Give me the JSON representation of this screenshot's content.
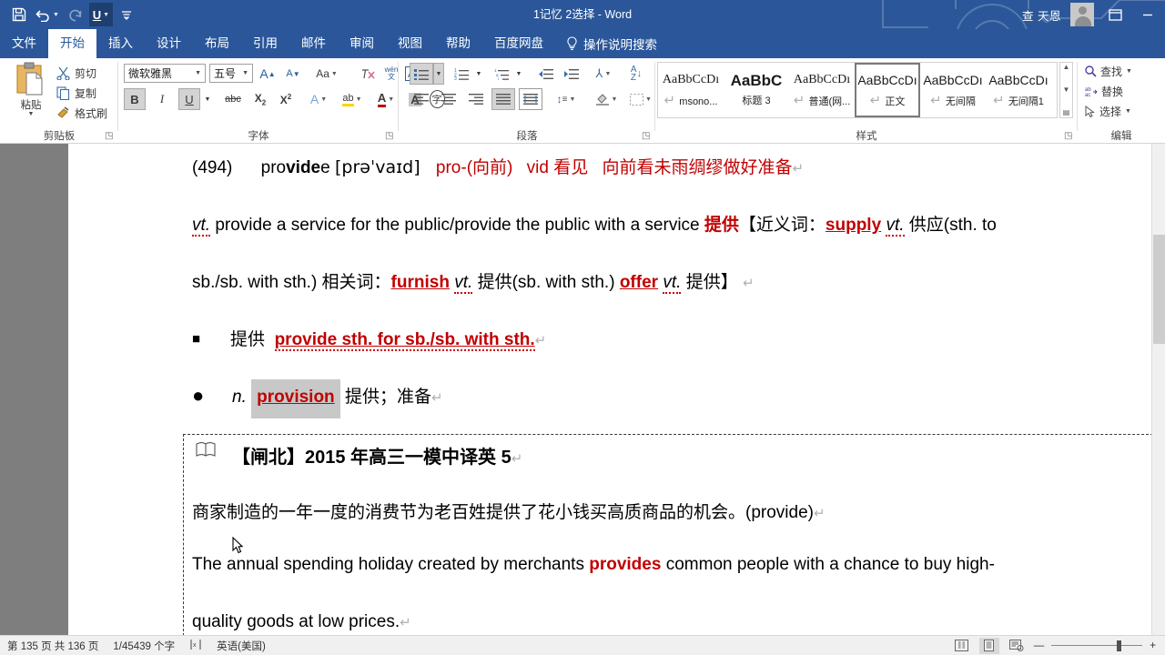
{
  "window": {
    "title": "1记忆 2选择  -  Word",
    "user_name": "查 天恩",
    "accent_color": "#2b579a",
    "quick_access": [
      {
        "name": "save",
        "glyph": "save-icon"
      },
      {
        "name": "undo",
        "glyph": "undo-icon"
      },
      {
        "name": "redo",
        "glyph": "redo-icon"
      },
      {
        "name": "underline",
        "glyph": "underline-icon",
        "label": "U"
      },
      {
        "name": "customize",
        "glyph": "chevron-down-icon"
      }
    ],
    "ribbon_display_options": "▣",
    "minimize": "—"
  },
  "tabs": [
    {
      "label": "文件",
      "selected": false
    },
    {
      "label": "开始",
      "selected": true
    },
    {
      "label": "插入",
      "selected": false
    },
    {
      "label": "设计",
      "selected": false
    },
    {
      "label": "布局",
      "selected": false
    },
    {
      "label": "引用",
      "selected": false
    },
    {
      "label": "邮件",
      "selected": false
    },
    {
      "label": "审阅",
      "selected": false
    },
    {
      "label": "视图",
      "selected": false
    },
    {
      "label": "帮助",
      "selected": false
    },
    {
      "label": "百度网盘",
      "selected": false
    }
  ],
  "tell_me": "操作说明搜索",
  "ribbon": {
    "clipboard": {
      "group_label": "剪贴板",
      "paste_label": "粘贴",
      "items": [
        {
          "label": "剪切",
          "icon": "scissors-icon"
        },
        {
          "label": "复制",
          "icon": "copy-icon"
        },
        {
          "label": "格式刷",
          "icon": "format-painter-icon"
        }
      ]
    },
    "font": {
      "group_label": "字体",
      "font_family": "微软雅黑",
      "font_size": "五号",
      "buttons": [
        {
          "name": "grow-font",
          "label": "A"
        },
        {
          "name": "shrink-font",
          "label": "A"
        },
        {
          "name": "change-case",
          "label": "Aa"
        },
        {
          "name": "clear-formatting",
          "label": "clear"
        },
        {
          "name": "phonetic-guide",
          "label": "wén"
        },
        {
          "name": "character-border",
          "label": "A"
        },
        {
          "name": "bold",
          "label": "B",
          "active": true
        },
        {
          "name": "italic",
          "label": "I",
          "active": false
        },
        {
          "name": "underline",
          "label": "U",
          "active": true
        },
        {
          "name": "strikethrough",
          "label": "abc"
        },
        {
          "name": "subscript",
          "label": "X₂"
        },
        {
          "name": "superscript",
          "label": "X²"
        },
        {
          "name": "text-effects",
          "label": "A"
        },
        {
          "name": "text-highlight",
          "label": "ab"
        },
        {
          "name": "font-color",
          "label": "A"
        },
        {
          "name": "character-shading",
          "label": "A"
        },
        {
          "name": "enclose-characters",
          "label": "字"
        }
      ]
    },
    "paragraph": {
      "group_label": "段落",
      "buttons": [
        {
          "name": "bullets",
          "active": true
        },
        {
          "name": "numbering",
          "active": false
        },
        {
          "name": "multilevel-list",
          "active": false
        },
        {
          "name": "decrease-indent",
          "active": false
        },
        {
          "name": "increase-indent",
          "active": false
        },
        {
          "name": "asian-layout",
          "active": false
        },
        {
          "name": "sort",
          "active": false
        },
        {
          "name": "show-formatting-marks",
          "active": false
        },
        {
          "name": "align-left",
          "active": false
        },
        {
          "name": "align-center",
          "active": false
        },
        {
          "name": "align-right",
          "active": false
        },
        {
          "name": "justify",
          "active": true
        },
        {
          "name": "distribute",
          "active": false
        },
        {
          "name": "line-spacing",
          "active": false
        },
        {
          "name": "shading",
          "active": false
        },
        {
          "name": "borders",
          "active": false
        }
      ]
    },
    "styles": {
      "group_label": "样式",
      "items": [
        {
          "preview": "AaBbCcDı",
          "name": "msono...",
          "pilcrow": true,
          "bold": false,
          "selected": false
        },
        {
          "preview": "AaBbC",
          "name": "标题 3",
          "pilcrow": false,
          "bold": true,
          "selected": false
        },
        {
          "preview": "AaBbCcDı",
          "name": "普通(网...",
          "pilcrow": true,
          "bold": false,
          "selected": false
        },
        {
          "preview": "AaBbCcDı",
          "name": "正文",
          "pilcrow": true,
          "bold": false,
          "selected": true
        },
        {
          "preview": "AaBbCcDı",
          "name": "无间隔",
          "pilcrow": true,
          "bold": false,
          "selected": false
        },
        {
          "preview": "AaBbCcDı",
          "name": "无间隔1",
          "pilcrow": true,
          "bold": false,
          "selected": false
        }
      ]
    },
    "editing": {
      "group_label": "编辑",
      "items": [
        {
          "label": "查找",
          "icon": "magnifier-icon",
          "has_arrow": true
        },
        {
          "label": "替换",
          "icon": "replace-icon",
          "has_arrow": false
        },
        {
          "label": "选择",
          "icon": "pointer-icon",
          "has_arrow": true
        }
      ]
    }
  },
  "document": {
    "line1": {
      "number": "(494)",
      "word_a": "pro",
      "word_b": "vide",
      "phonetic": "[prəˈvaɪd]",
      "root1": "pro-(向前)",
      "root2": "vid 看见",
      "mnemonic": "向前看未雨绸缪做好准备",
      "pilcrow": "↵"
    },
    "line2": {
      "pos": "vt.",
      "text_a": " provide a service for the public/provide the public with a service ",
      "cn_a": "提供",
      "bracket_a": "【近义词：",
      "syn": "supply",
      "pos2": "vt.",
      "cn_b": "供应(sth. to"
    },
    "line3": {
      "text_a": "sb./sb. with sth.)  相关词：",
      "rel1": "furnish",
      "pos1": "vt.",
      "cn1": "提供(sb. with sth.)",
      "rel2": "offer",
      "pos2": "vt.",
      "cn2": "提供】",
      "pilcrow": "↵"
    },
    "line4": {
      "bullet": "■",
      "cn": "提供",
      "phrase": "provide sth. for sb./sb. with sth.",
      "pilcrow": "↵"
    },
    "line5": {
      "bullet": "●",
      "pos": "n.",
      "word": "provision",
      "cn": "提供；准备",
      "pilcrow": "↵",
      "selected": true
    },
    "exercise": {
      "icon": "book-icon",
      "heading": "【闸北】2015 年高三一模中译英 5",
      "heading_pilcrow": "↵",
      "chinese": "商家制造的一年一度的消费节为老百姓提供了花小钱买高质商品的机会。(provide)",
      "chinese_pilcrow": "↵",
      "english_a": "The annual spending holiday created by merchants ",
      "english_key": "provides",
      "english_b": " common people with a chance to buy high-",
      "english_c": "quality goods at low prices.",
      "english_pilcrow": "↵"
    }
  },
  "status_bar": {
    "page_info": "第 135 页  共 136 页",
    "word_count": "1/45439 个字",
    "proofing_icon": "proofing-icon",
    "language": "英语(美国)",
    "views": [
      {
        "name": "read-mode",
        "active": false
      },
      {
        "name": "print-layout",
        "active": true
      },
      {
        "name": "web-layout",
        "active": false
      }
    ],
    "zoom_out": "—",
    "zoom_in": "+"
  }
}
